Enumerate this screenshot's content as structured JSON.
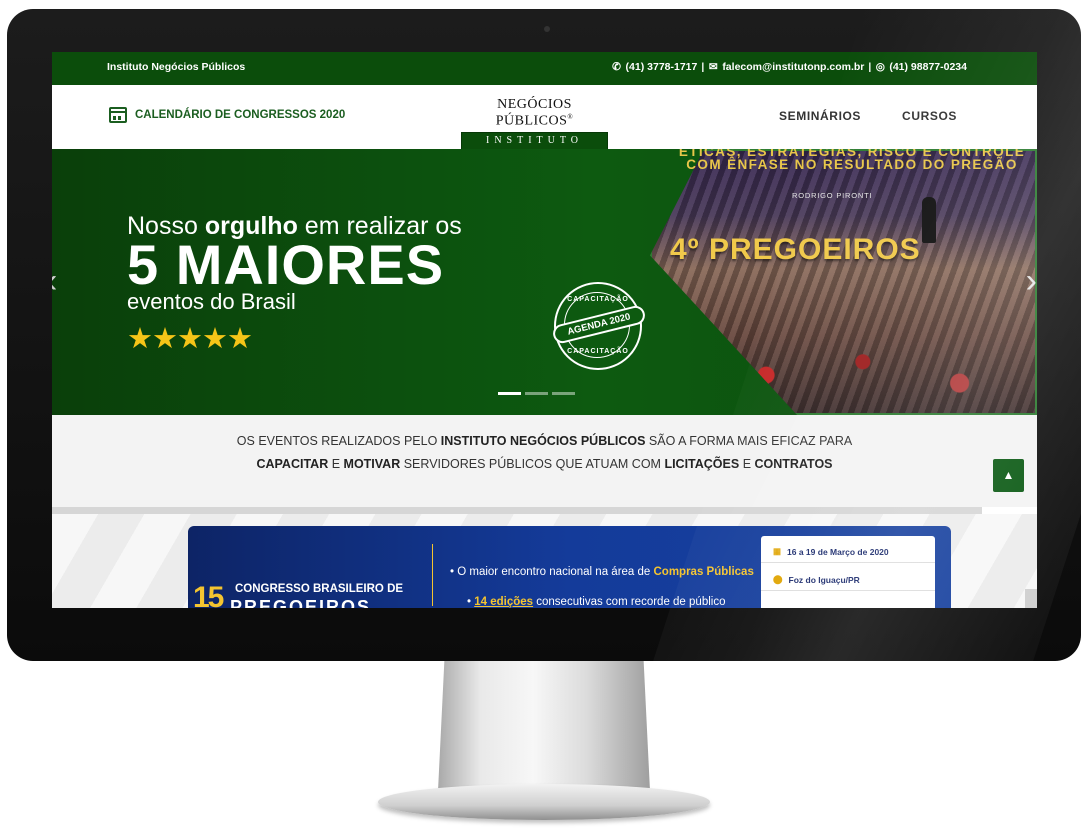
{
  "topbar": {
    "brand": "Instituto Negócios Públicos",
    "phone": "(41) 3778-1717",
    "email": "falecom@institutonp.com.br",
    "whatsapp": "(41) 98877-0234",
    "separator": "|"
  },
  "nav": {
    "calendar_link": "CALENDÁRIO DE CONGRESSOS 2020",
    "logo_top": "NEGÓCIOS PÚBLICOS",
    "logo_reg": "®",
    "logo_bottom": "INSTITUTO",
    "menu": [
      "SEMINÁRIOS",
      "CURSOS"
    ]
  },
  "hero": {
    "line1_pre": "Nosso ",
    "line1_bold": "orgulho",
    "line1_post": " em realizar os",
    "big": "5 MAIORES",
    "line3": "eventos do Brasil",
    "stars": "★★★★★",
    "photo_heading_1": "ÉTICAS, ESTRATÉGIAS, RISCO E CONTROLE",
    "photo_heading_2": "COM ÊNFASE NO RESULTADO DO PREGÃO",
    "photo_speaker": "RODRIGO PIRONTI",
    "photo_big": "4º PREGOEIROS",
    "badge_top": "CAPACITAÇÃO",
    "badge_center": "AGENDA 2020",
    "badge_bottom": "CAPACITAÇÃO",
    "slides": 3,
    "active_slide": 1
  },
  "tagline": {
    "p1_pre": "OS EVENTOS REALIZADOS PELO ",
    "p1_bold": "INSTITUTO NEGÓCIOS PÚBLICOS",
    "p1_post": " SÃO A FORMA MAIS EFICAZ PARA",
    "p2_b1": "CAPACITAR",
    "p2_t1": " E ",
    "p2_b2": "MOTIVAR",
    "p2_t2": " SERVIDORES PÚBLICOS QUE ATUAM COM ",
    "p2_b3": "LICITAÇÕES",
    "p2_t3": " E ",
    "p2_b4": "CONTRATOS"
  },
  "event": {
    "number": "15",
    "title_line1": "CONGRESSO BRASILEIRO DE",
    "title_line2": "PREGOEIROS",
    "bullet1_pre": "O maior encontro nacional na área de ",
    "bullet1_hl": "Compras Públicas",
    "bullet2_hl": "14 edições",
    "bullet2_post": " consecutivas com recorde de público",
    "date": "16 a 19 de Março de 2020",
    "location": "Foz do Iguaçu/PR"
  },
  "colors": {
    "brand_green": "#0b4d0b",
    "accent_yellow": "#f4c430",
    "event_blue": "#143b9a"
  },
  "icons": [
    "phone-icon",
    "envelope-icon",
    "whatsapp-icon",
    "calendar-icon",
    "chevron-left-icon",
    "chevron-right-icon",
    "chevron-up-icon",
    "map-pin-icon"
  ]
}
